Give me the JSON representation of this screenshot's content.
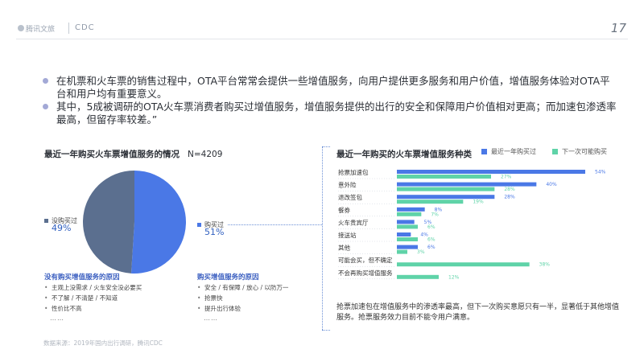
{
  "header": {
    "logo_tencent": "腾讯文旅",
    "logo_cdc": "CDC",
    "page_number": "17"
  },
  "bullets": [
    "在机票和火车票的销售过程中，OTA平台常常会提供一些增值服务，向用户提供更多服务和用户价值，增值服务体验对OTA平台和用户均有重要意义。",
    "其中，5成被调研的OTA火车票消费者购买过增值服务，增值服务提供的出行的安全和保障用户价值相对更高；而加速包渗透率最高，但留存率较差。”"
  ],
  "left": {
    "title": "最近一年购买火车票增值服务的情况",
    "sample": "N=4209",
    "not_bought_title": "没有购买增值服务的原因",
    "not_bought_reasons": [
      "主观上没需求 / 火车安全没必要买",
      "不了解 / 不清楚 / 不知道",
      "性价比不高"
    ],
    "bought_title": "购买增值服务的原因",
    "bought_reasons": [
      "安全 / 有保障 / 放心 / 以防万一",
      "抢票快",
      "提升出行体验"
    ],
    "more": "……"
  },
  "right": {
    "title": "最近一年购买的火车票增值服务种类",
    "footnote": "抢票加速包在增值服务中的渗透率最高，但下一次购买意愿只有一半，显著低于其他增值服务。抢票服务效力目前不能令用户满意。"
  },
  "source": "数据来源：2019年国内出行调研，腾讯CDC",
  "colors": {
    "blue": "#4a78e6",
    "green": "#5fd3a8",
    "slate": "#5b6f8f",
    "bullet": "#a3a9d6"
  },
  "chart_data": [
    {
      "type": "pie",
      "categories": [
        "没购买过",
        "购买过"
      ],
      "values": [
        49,
        51
      ],
      "value_labels": [
        "49%",
        "51%"
      ],
      "colors": [
        "#5b6f8f",
        "#4a78e6"
      ]
    },
    {
      "type": "bar",
      "orientation": "horizontal",
      "categories": [
        "抢票加速包",
        "意外险",
        "退改签包",
        "餐券",
        "火车贵宾厅",
        "接送站",
        "其他",
        "可能会买，但不确定",
        "不会再购买增值服务"
      ],
      "series": [
        {
          "name": "最近一年购买过",
          "values": [
            54,
            40,
            28,
            8,
            5,
            4,
            6,
            null,
            null
          ],
          "labels": [
            "54%",
            "40%",
            "28%",
            "8%",
            "5%",
            "4%",
            "6%",
            "",
            ""
          ]
        },
        {
          "name": "下一次可能购买",
          "values": [
            27,
            28,
            19,
            7,
            6,
            6,
            3,
            38,
            12
          ],
          "labels": [
            "27%",
            "28%",
            "19%",
            "7%",
            "6%",
            "6%",
            "3%",
            "38%",
            "12%"
          ]
        }
      ],
      "xlim": [
        0,
        60
      ],
      "legend": "top-right"
    }
  ]
}
